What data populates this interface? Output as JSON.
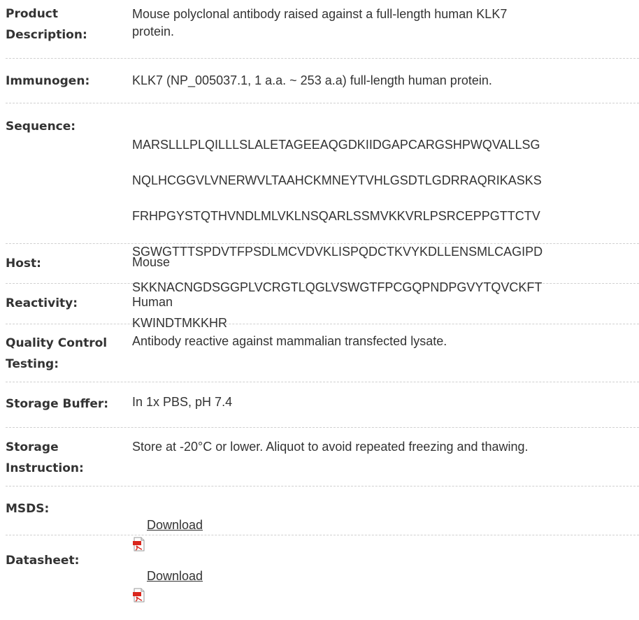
{
  "rows": [
    {
      "label": "Product\nDescription:",
      "value": "Mouse polyclonal antibody raised against a full-length human KLK7\nprotein."
    },
    {
      "label": "Immunogen:",
      "value": "KLK7 (NP_005037.1, 1 a.a. ~ 253 a.a) full-length human protein."
    },
    {
      "label": "Sequence:",
      "sequence_lines": [
        "MARSLLLPLQILLLSLALETAGEEAQGDKIIDGAPCARGSHPWQVALLSG",
        "NQLHCGGVLVNERWVLTAAHCKMNEYTVHLGSDTLGDRRAQRIKASKS",
        "FRHPGYSTQTHVNDLMLVKLNSQARLSSMVKKVRLPSRCEPPGTTCTV",
        "SGWGTTTSPDVTFPSDLMCVDVKLISPQDCTKVYKDLLENSMLCAGIPD",
        "SKKNACNGDSGGPLVCRGTLQGLVSWGTFPCGQPNDPGVYTQVCKFT",
        "KWINDTMKKHR"
      ]
    },
    {
      "label": "Host:",
      "value": "Mouse"
    },
    {
      "label": "Reactivity:",
      "value": "Human"
    },
    {
      "label": "Quality Control\nTesting:",
      "value": "Antibody reactive against mammalian transfected lysate."
    },
    {
      "label": "Storage Buffer:",
      "value": "In 1x PBS, pH 7.4"
    },
    {
      "label": "Storage\nInstruction:",
      "value": "Store at -20°C or lower. Aliquot to avoid repeated freezing and thawing."
    },
    {
      "label": "MSDS:",
      "link_label": "Download",
      "icon": "pdf-icon"
    },
    {
      "label": "Datasheet:",
      "link_label": "Download",
      "icon": "pdf-icon"
    }
  ],
  "colors": {
    "text": "#333333",
    "divider": "#d0d0d0",
    "pdf_red": "#d9261c"
  }
}
